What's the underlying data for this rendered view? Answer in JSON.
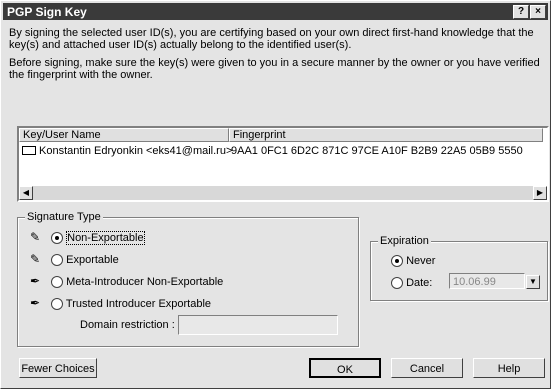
{
  "window": {
    "title": "PGP Sign Key",
    "help_icon": "?",
    "close_icon": "×"
  },
  "intro": {
    "line1": "By signing the selected user ID(s), you are certifying based on your own direct first-hand knowledge that the key(s) and attached user ID(s) actually belong to the identified user(s).",
    "line2": "Before signing, make sure the key(s) were given to you in a secure manner by the owner or you have verified the fingerprint with the owner."
  },
  "list": {
    "headers": {
      "key": "Key/User Name",
      "fingerprint": "Fingerprint"
    },
    "row": {
      "name": "Konstantin Edryonkin <eks41@mail.ru>",
      "fingerprint": "9AA1 0FC1 6D2C 871C 97CE  A10F B2B9 22A5 05B9 5550"
    }
  },
  "signature_type": {
    "legend": "Signature Type",
    "options": [
      "Non-Exportable",
      "Exportable",
      "Meta-Introducer Non-Exportable",
      "Trusted Introducer Exportable"
    ],
    "selected": "Non-Exportable",
    "domain_label": "Domain restriction :",
    "domain_value": ""
  },
  "expiration": {
    "legend": "Expiration",
    "never": "Never",
    "date": "Date:",
    "date_value": "10.06.99",
    "selected": "Never"
  },
  "buttons": {
    "fewer": "Fewer Choices",
    "ok": "OK",
    "cancel": "Cancel",
    "help": "Help"
  }
}
